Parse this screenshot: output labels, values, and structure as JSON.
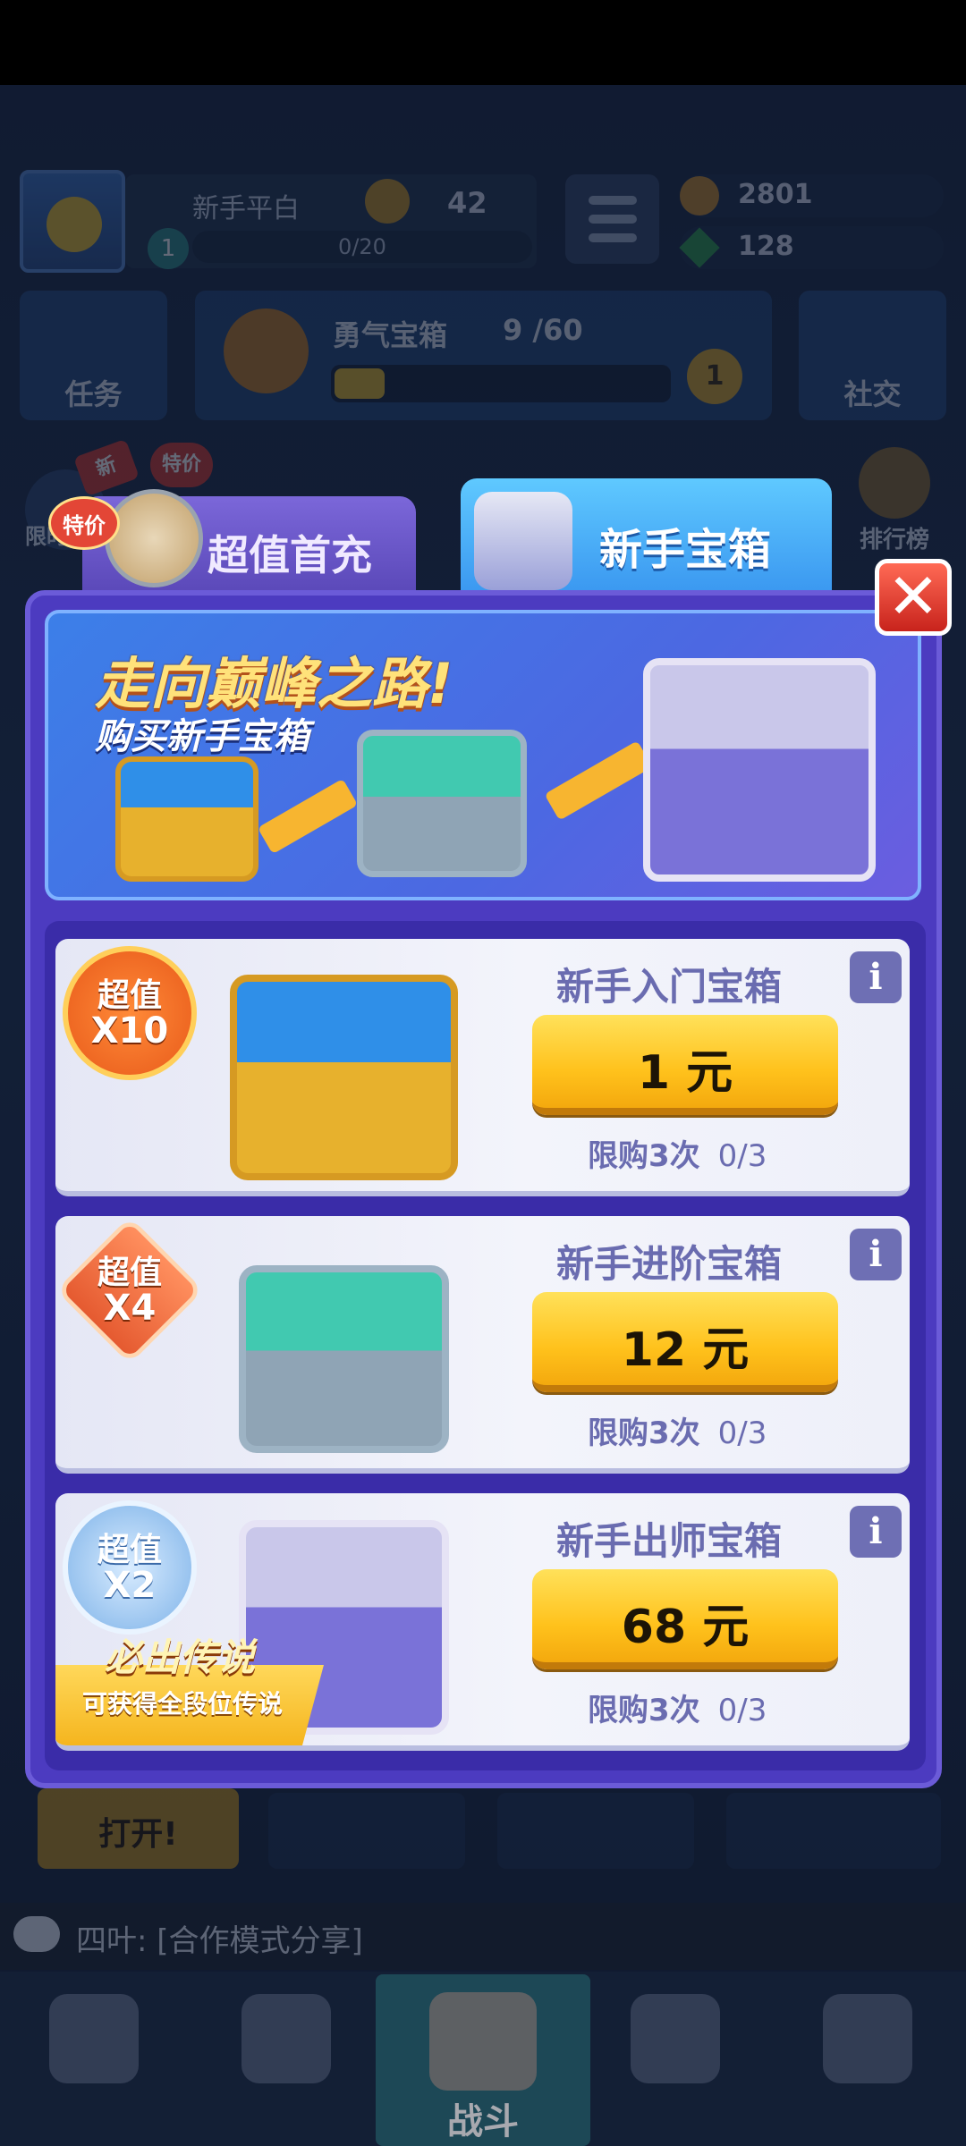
{
  "hud": {
    "player_name": "新手平白",
    "trophies": "42",
    "level": "1",
    "xp": "0/20",
    "coins": "2801",
    "gems": "128",
    "tasks_label": "任务",
    "brave_chest": {
      "title": "勇气宝箱",
      "count": "9 /60",
      "progress": 0.15,
      "reward": "1"
    },
    "social_label": "社交",
    "leaderboard_label": "排行榜",
    "limited_label": "限时",
    "new_badge": "新",
    "special_badge": "特价"
  },
  "tabs": [
    {
      "label": "超值首充",
      "badge": "特价",
      "active": false
    },
    {
      "label": "新手宝箱",
      "active": true
    }
  ],
  "banner": {
    "title": "走向巅峰之路!",
    "subtitle": "购买新手宝箱"
  },
  "offers": [
    {
      "name": "新手入门宝箱",
      "price": "1 元",
      "badge_top": "超值",
      "badge_bottom": "X10",
      "limit_label": "限购3次",
      "limit_progress": "0/3"
    },
    {
      "name": "新手进阶宝箱",
      "price": "12 元",
      "badge_top": "超值",
      "badge_bottom": "X4",
      "limit_label": "限购3次",
      "limit_progress": "0/3"
    },
    {
      "name": "新手出师宝箱",
      "price": "68 元",
      "badge_top": "超值",
      "badge_bottom": "X2",
      "limit_label": "限购3次",
      "limit_progress": "0/3",
      "ribbon_title": "必出传说",
      "ribbon_sub": "可获得全段位传说"
    }
  ],
  "info_icon": "i",
  "close_icon": "✕",
  "open_button": "打开!",
  "chat": {
    "message": "四叶: [合作模式分享]"
  },
  "nav": {
    "battle_label": "战斗"
  },
  "colors": {
    "panel": "#4c3bc0",
    "buy_button": "#ffc21c",
    "close": "#d9342a"
  }
}
